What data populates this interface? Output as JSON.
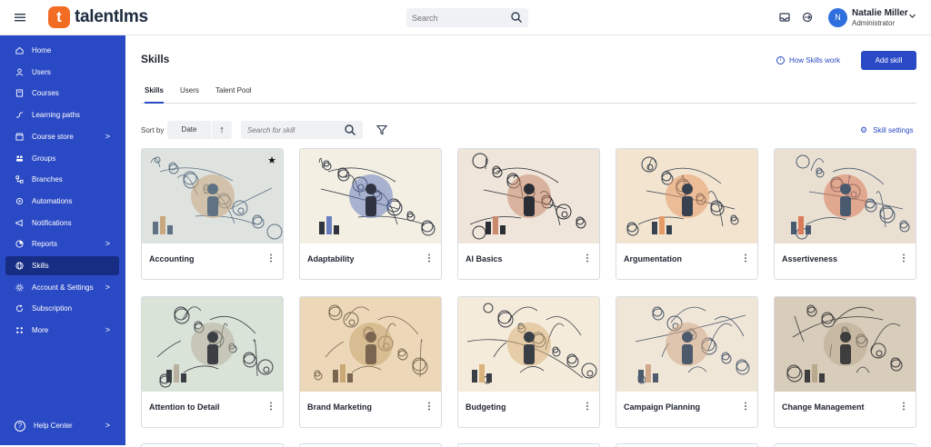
{
  "app": {
    "logo_mark": "t",
    "logo_text": "talentlms",
    "search_placeholder": "Search",
    "user": {
      "name": "Natalie Miller",
      "role": "Administrator",
      "initial": "N"
    }
  },
  "sidebar": {
    "items": [
      {
        "label": "Home",
        "icon": "home-icon"
      },
      {
        "label": "Users",
        "icon": "user-icon"
      },
      {
        "label": "Courses",
        "icon": "book-icon"
      },
      {
        "label": "Learning paths",
        "icon": "path-icon"
      },
      {
        "label": "Course store",
        "icon": "store-icon",
        "chevron": ">"
      },
      {
        "label": "Groups",
        "icon": "groups-icon"
      },
      {
        "label": "Branches",
        "icon": "branches-icon"
      },
      {
        "label": "Automations",
        "icon": "automations-icon"
      },
      {
        "label": "Notifications",
        "icon": "megaphone-icon"
      },
      {
        "label": "Reports",
        "icon": "pie-chart-icon",
        "chevron": ">"
      },
      {
        "label": "Skills",
        "icon": "globe-icon",
        "active": true
      },
      {
        "label": "Account & Settings",
        "icon": "gear-icon",
        "chevron": ">"
      },
      {
        "label": "Subscription",
        "icon": "refresh-icon"
      },
      {
        "label": "More",
        "icon": "grid-icon",
        "chevron": ">"
      }
    ],
    "help": {
      "label": "Help Center",
      "icon_glyph": "?",
      "chevron": ">"
    }
  },
  "page": {
    "title": "Skills",
    "how_link": "How Skills work",
    "info_glyph": "i",
    "add_button": "Add skill",
    "tabs": [
      "Skills",
      "Users",
      "Talent Pool"
    ],
    "sort_label": "Sort by",
    "sort_value": "Date",
    "sort_arrow": "↑",
    "search_placeholder": "Search for skill",
    "settings_link": "Skill settings",
    "settings_glyph": "⚙",
    "more_glyph": "⋮",
    "star_glyph": "★"
  },
  "skills": [
    {
      "name": "Accounting",
      "palette": [
        "#dfe3e0",
        "#5f7384",
        "#c9a77f"
      ],
      "starred": true
    },
    {
      "name": "Adaptability",
      "palette": [
        "#f3efe3",
        "#2f3440",
        "#6a7fc0"
      ]
    },
    {
      "name": "AI Basics",
      "palette": [
        "#efe5da",
        "#2a2d33",
        "#c98a6e"
      ]
    },
    {
      "name": "Argumentation",
      "palette": [
        "#f2e4cf",
        "#38414f",
        "#e59a68"
      ]
    },
    {
      "name": "Assertiveness",
      "palette": [
        "#eae0d2",
        "#4a5a6e",
        "#d97a5a"
      ]
    },
    {
      "name": "Attention to Detail",
      "palette": [
        "#d9e3d8",
        "#3b3f44",
        "#b8b0a0"
      ]
    },
    {
      "name": "Brand Marketing",
      "palette": [
        "#ecd8b8",
        "#7a6650",
        "#c9a875"
      ]
    },
    {
      "name": "Budgeting",
      "palette": [
        "#f5ebdb",
        "#3a3f46",
        "#d9b27c"
      ]
    },
    {
      "name": "Campaign Planning",
      "palette": [
        "#f0e6d8",
        "#4d5a6c",
        "#d1a98a"
      ]
    },
    {
      "name": "Change Management",
      "palette": [
        "#d8ccba",
        "#3d3d3d",
        "#b8a88c"
      ]
    }
  ]
}
